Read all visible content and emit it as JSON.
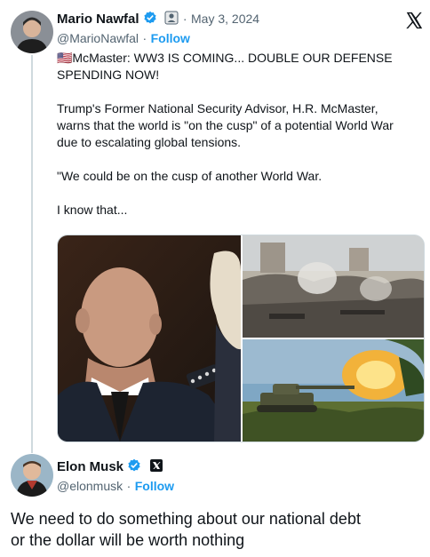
{
  "tweet": {
    "author_name": "Mario Nawfal",
    "handle": "@MarioNawfal",
    "follow_label": "Follow",
    "separator": "·",
    "date": "May 3, 2024",
    "line1": "🇺🇸McMaster: WW3 IS COMING... DOUBLE OUR DEFENSE",
    "line2": "SPENDING NOW!",
    "para2_line1": "Trump's Former National Security Advisor, H.R. McMaster,",
    "para2_line2": "warns that the world is \"on the cusp\" of a potential World War",
    "para2_line3": "due to escalating global tensions.",
    "para3": "\"We could be on the cusp of another World War.",
    "para4": "I know that...",
    "icons": [
      "verified-badge-icon",
      "affiliate-badge-icon",
      "x-logo-icon"
    ]
  },
  "reply": {
    "author_name": "Elon Musk",
    "handle": "@elonmusk",
    "follow_label": "Follow",
    "separator": "·",
    "text_line1": "We need to do something about our national debt",
    "text_line2": "or the dollar will be worth nothing",
    "icons": [
      "verified-badge-icon",
      "x-affiliate-icon"
    ]
  },
  "colors": {
    "accent": "#1d9bf0",
    "text": "#0f1419",
    "secondary": "#536471",
    "border": "#cfd9de"
  }
}
